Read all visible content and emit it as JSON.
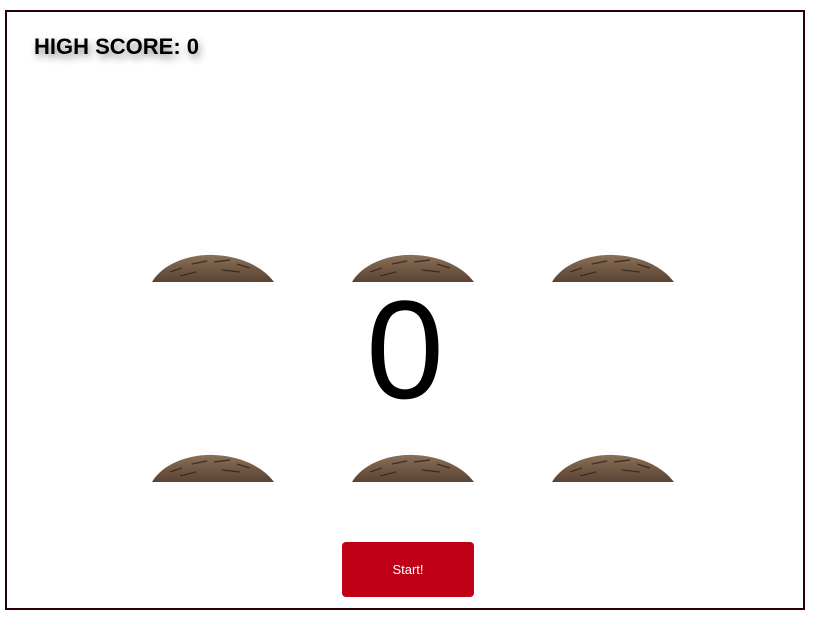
{
  "high_score": {
    "text": "HIGH SCORE: 0"
  },
  "game": {
    "score": "0",
    "holes": [
      {
        "row": 1,
        "col": 1
      },
      {
        "row": 1,
        "col": 2
      },
      {
        "row": 1,
        "col": 3
      },
      {
        "row": 2,
        "col": 1
      },
      {
        "row": 2,
        "col": 2
      },
      {
        "row": 2,
        "col": 3
      }
    ]
  },
  "controls": {
    "start_label": "Start!"
  },
  "colors": {
    "frame_border": "#2a0000",
    "start_button_bg": "#bf0016",
    "start_button_text": "#ffffff",
    "mound": "#6e5541"
  }
}
